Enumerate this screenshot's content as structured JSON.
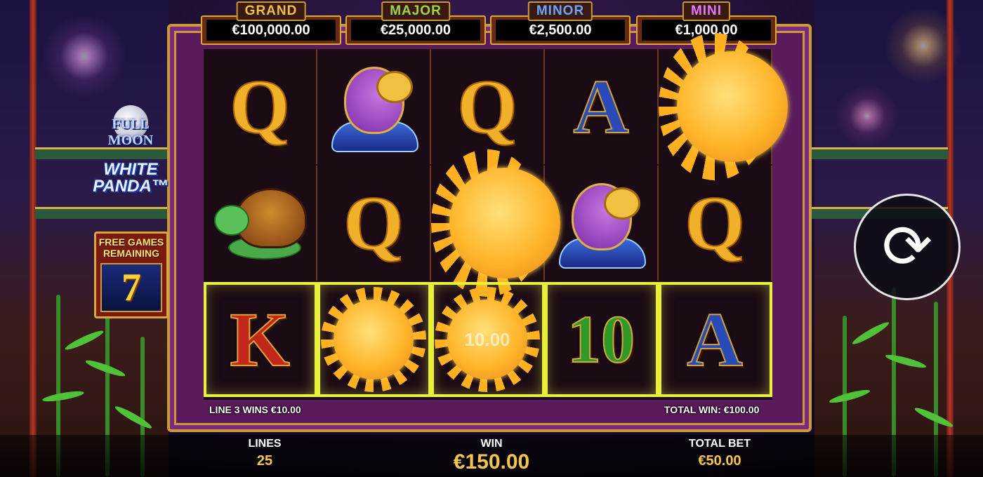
{
  "jackpots": [
    {
      "label": "GRAND",
      "value": "€100,000.00",
      "label_color": "#e9c24a"
    },
    {
      "label": "MAJOR",
      "value": "€25,000.00",
      "label_color": "#9bd64a"
    },
    {
      "label": "MINOR",
      "value": "€2,500.00",
      "label_color": "#6aa6ff"
    },
    {
      "label": "MINI",
      "value": "€1,000.00",
      "label_color": "#e07aff"
    }
  ],
  "logo": {
    "line1": "FULL MOON",
    "line2": "WHITE",
    "line3": "PANDA™"
  },
  "free_games": {
    "title_line1": "FREE GAMES",
    "title_line2": "REMAINING",
    "count": "7"
  },
  "reels": [
    [
      "Q",
      "turtle",
      "K"
    ],
    [
      "fish",
      "Q",
      "sun"
    ],
    [
      "Q",
      "sun",
      "sun"
    ],
    [
      "A",
      "fish",
      "10"
    ],
    [
      "sun",
      "Q",
      "A"
    ]
  ],
  "winning_row": 2,
  "sun_value": "10.00",
  "line_win_text": "LINE 3 WINS €10.00",
  "total_win_text": "TOTAL WIN: €100.00",
  "spin_icon": "refresh-icon",
  "bottom": {
    "lines_label": "LINES",
    "lines_value": "25",
    "win_label": "WIN",
    "win_value": "€150.00",
    "bet_label": "TOTAL BET",
    "bet_value": "€50.00"
  }
}
